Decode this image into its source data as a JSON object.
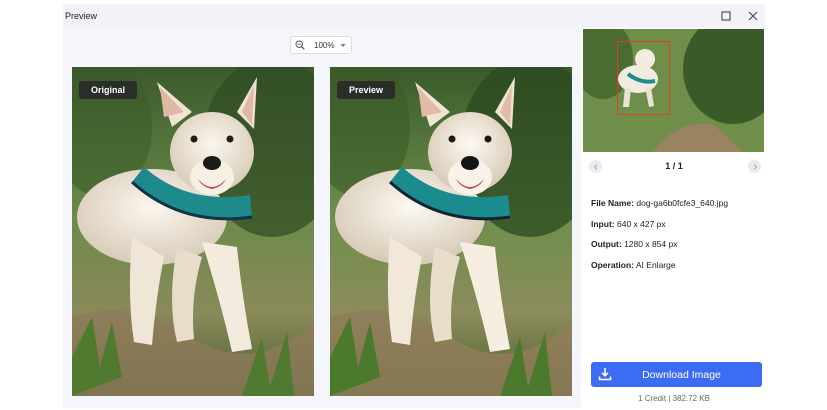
{
  "window": {
    "title": "Preview"
  },
  "toolbar": {
    "zoom_level": "100%"
  },
  "panes": {
    "original_label": "Original",
    "preview_label": "Preview"
  },
  "pager": {
    "page_text": "1 / 1"
  },
  "file_info": {
    "file_name_label": "File Name:",
    "file_name_value": "dog-ga6b0fcfe3_640.jpg",
    "input_label": "Input:",
    "input_value": "640 x 427 px",
    "output_label": "Output:",
    "output_value": "1280 x 854 px",
    "operation_label": "Operation:",
    "operation_value": "AI Enlarge"
  },
  "actions": {
    "download_label": "Download Image",
    "credit_text": "1 Credit | 382.72 KB"
  },
  "colors": {
    "accent": "#3d6cf4",
    "selection": "#e0401f"
  }
}
